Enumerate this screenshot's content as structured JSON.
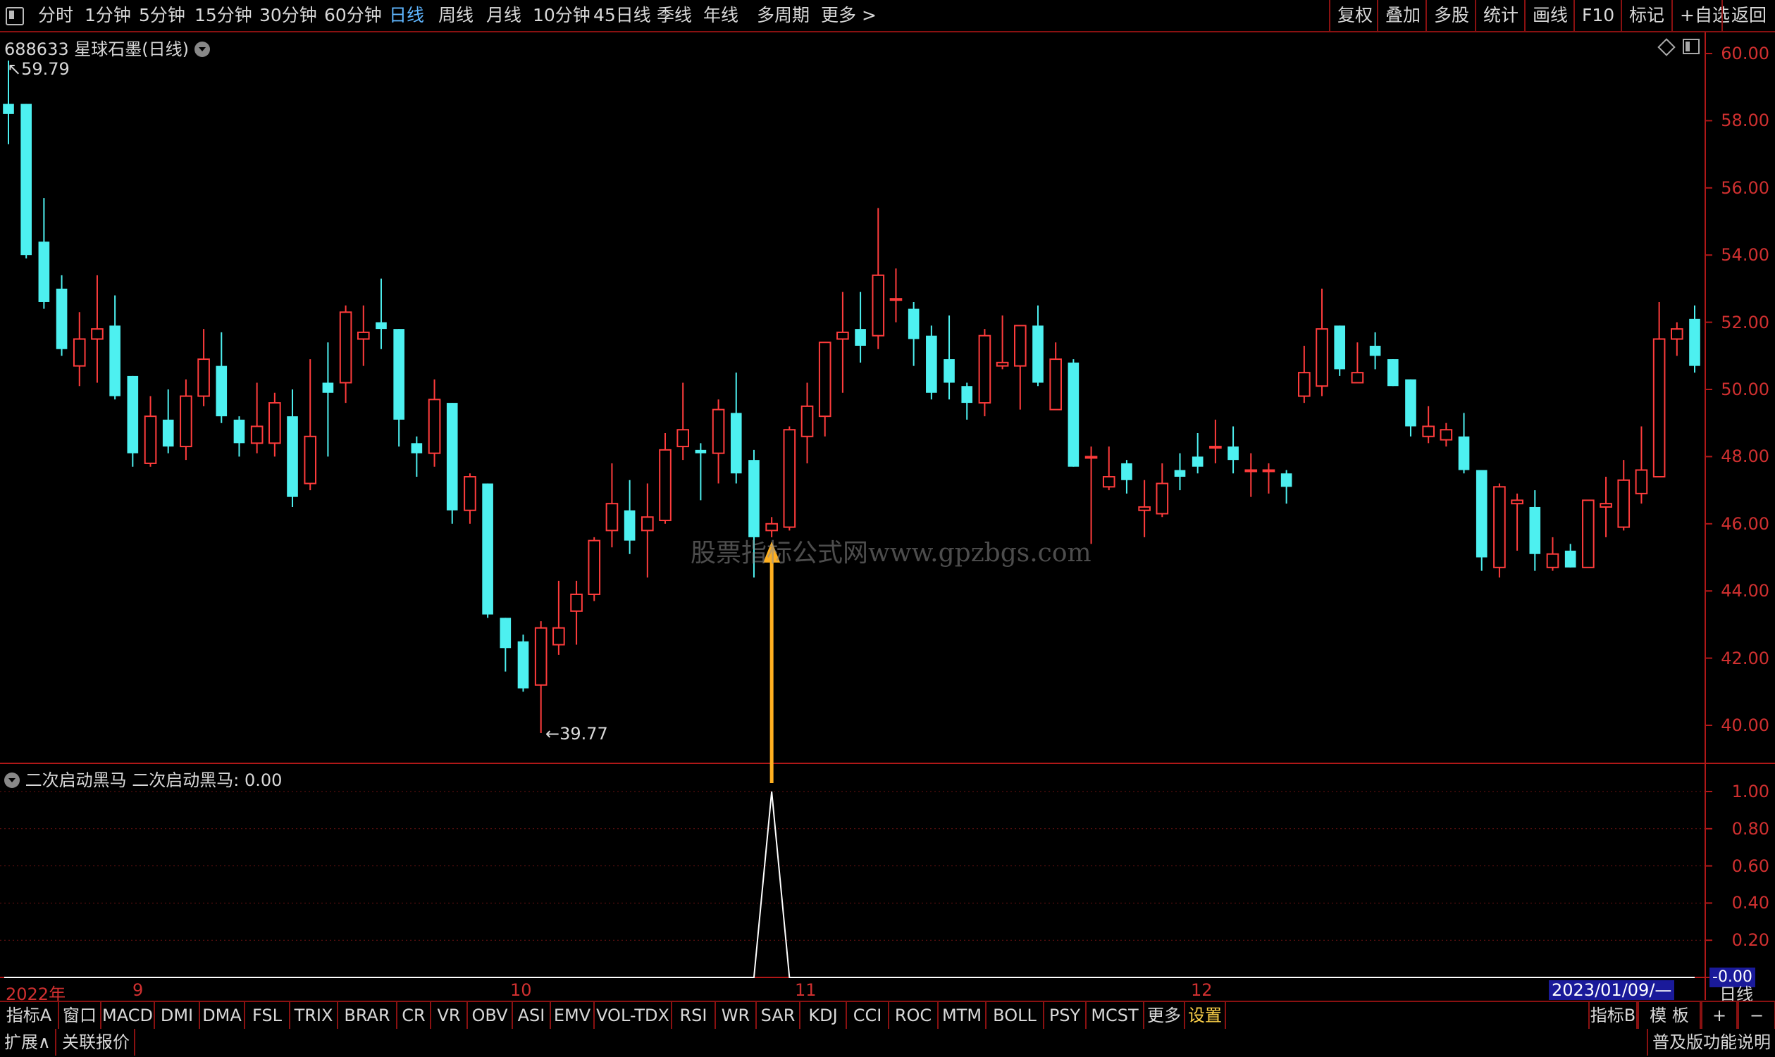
{
  "topbar": {
    "periods": [
      {
        "label": "分时",
        "active": false
      },
      {
        "label": "1分钟",
        "active": false
      },
      {
        "label": "5分钟",
        "active": false
      },
      {
        "label": "15分钟",
        "active": false
      },
      {
        "label": "30分钟",
        "active": false
      },
      {
        "label": "60分钟",
        "active": false
      },
      {
        "label": "日线",
        "active": true
      },
      {
        "label": "周线",
        "active": false
      },
      {
        "label": "月线",
        "active": false
      },
      {
        "label": "10分钟",
        "active": false
      },
      {
        "label": "45日线",
        "active": false
      },
      {
        "label": "季线",
        "active": false
      },
      {
        "label": "年线",
        "active": false
      },
      {
        "label": "多周期",
        "active": false
      },
      {
        "label": "更多 >",
        "active": false
      }
    ],
    "right_buttons": [
      "复权",
      "叠加",
      "多股",
      "统计",
      "画线",
      "F10",
      "标记",
      "+自选",
      "返回"
    ]
  },
  "chart_header": {
    "title": "688633 星球石墨(日线)",
    "high_marker": "59.79",
    "low_marker": "39.77"
  },
  "indicator_header": {
    "name": "二次启动黑马",
    "value_text": "二次启动黑马: 0.00"
  },
  "watermark": "股票指标公式网www.gpzbgs.com",
  "x_axis": {
    "year_label": "2022年",
    "months": [
      "9",
      "10",
      "11",
      "12"
    ],
    "date_badge": "2023/01/09/—",
    "period_label": "日线"
  },
  "colors": {
    "up": "#ff3c3c",
    "down": "#4df0f0",
    "axis": "#b01818",
    "signal_arrow": "#ffb020"
  },
  "chart_data": [
    {
      "type": "candlestick",
      "title": "688633 星球石墨(日线)",
      "ylim": [
        39,
        60.4
      ],
      "y_ticks": [
        "60.00",
        "58.00",
        "56.00",
        "54.00",
        "52.00",
        "50.00",
        "48.00",
        "46.00",
        "44.00",
        "42.00",
        "40.00"
      ],
      "candles": [
        {
          "o": 58.5,
          "c": 58.2,
          "h": 59.79,
          "l": 57.3
        },
        {
          "o": 58.5,
          "c": 54.0,
          "h": 58.5,
          "l": 53.9
        },
        {
          "o": 54.4,
          "c": 52.6,
          "h": 55.7,
          "l": 52.4
        },
        {
          "o": 53.0,
          "c": 51.2,
          "h": 53.4,
          "l": 51.0
        },
        {
          "o": 50.7,
          "c": 51.5,
          "h": 52.3,
          "l": 50.1
        },
        {
          "o": 51.5,
          "c": 51.8,
          "h": 53.4,
          "l": 50.2
        },
        {
          "o": 51.9,
          "c": 49.8,
          "h": 52.8,
          "l": 49.7
        },
        {
          "o": 50.4,
          "c": 48.1,
          "h": 50.4,
          "l": 47.7
        },
        {
          "o": 47.8,
          "c": 49.2,
          "h": 49.8,
          "l": 47.7
        },
        {
          "o": 49.1,
          "c": 48.3,
          "h": 50.0,
          "l": 48.1
        },
        {
          "o": 48.3,
          "c": 49.8,
          "h": 50.3,
          "l": 47.9
        },
        {
          "o": 49.8,
          "c": 50.9,
          "h": 51.8,
          "l": 49.5
        },
        {
          "o": 50.7,
          "c": 49.2,
          "h": 51.7,
          "l": 49.0
        },
        {
          "o": 49.1,
          "c": 48.4,
          "h": 49.2,
          "l": 48.0
        },
        {
          "o": 48.4,
          "c": 48.9,
          "h": 50.2,
          "l": 48.1
        },
        {
          "o": 48.4,
          "c": 49.6,
          "h": 49.9,
          "l": 48.0
        },
        {
          "o": 49.2,
          "c": 46.8,
          "h": 50.0,
          "l": 46.5
        },
        {
          "o": 47.2,
          "c": 48.6,
          "h": 50.9,
          "l": 47.0
        },
        {
          "o": 50.2,
          "c": 49.9,
          "h": 51.4,
          "l": 48.0
        },
        {
          "o": 50.2,
          "c": 52.3,
          "h": 52.5,
          "l": 49.6
        },
        {
          "o": 51.5,
          "c": 51.7,
          "h": 52.5,
          "l": 50.7
        },
        {
          "o": 52.0,
          "c": 51.8,
          "h": 53.3,
          "l": 51.2
        },
        {
          "o": 51.8,
          "c": 49.1,
          "h": 51.8,
          "l": 48.3
        },
        {
          "o": 48.4,
          "c": 48.1,
          "h": 48.6,
          "l": 47.4
        },
        {
          "o": 48.1,
          "c": 49.7,
          "h": 50.3,
          "l": 47.7
        },
        {
          "o": 49.6,
          "c": 46.4,
          "h": 49.6,
          "l": 46.0
        },
        {
          "o": 46.4,
          "c": 47.4,
          "h": 47.5,
          "l": 46.0
        },
        {
          "o": 47.2,
          "c": 43.3,
          "h": 47.2,
          "l": 43.2
        },
        {
          "o": 43.2,
          "c": 42.3,
          "h": 43.2,
          "l": 41.6
        },
        {
          "o": 42.5,
          "c": 41.1,
          "h": 42.7,
          "l": 41.0
        },
        {
          "o": 41.2,
          "c": 42.9,
          "h": 43.1,
          "l": 39.77
        },
        {
          "o": 42.4,
          "c": 42.9,
          "h": 44.3,
          "l": 42.1
        },
        {
          "o": 43.4,
          "c": 43.9,
          "h": 44.3,
          "l": 42.4
        },
        {
          "o": 43.9,
          "c": 45.5,
          "h": 45.6,
          "l": 43.7
        },
        {
          "o": 45.8,
          "c": 46.6,
          "h": 47.8,
          "l": 45.3
        },
        {
          "o": 46.4,
          "c": 45.5,
          "h": 47.3,
          "l": 45.1
        },
        {
          "o": 45.8,
          "c": 46.2,
          "h": 47.2,
          "l": 44.4
        },
        {
          "o": 46.1,
          "c": 48.2,
          "h": 48.7,
          "l": 46.0
        },
        {
          "o": 48.3,
          "c": 48.8,
          "h": 50.2,
          "l": 47.9
        },
        {
          "o": 48.2,
          "c": 48.1,
          "h": 48.4,
          "l": 46.7
        },
        {
          "o": 48.1,
          "c": 49.4,
          "h": 49.7,
          "l": 47.2
        },
        {
          "o": 49.3,
          "c": 47.5,
          "h": 50.5,
          "l": 47.2
        },
        {
          "o": 47.9,
          "c": 45.6,
          "h": 48.2,
          "l": 44.4
        },
        {
          "o": 45.8,
          "c": 46.0,
          "h": 46.2,
          "l": 45.6
        },
        {
          "o": 45.9,
          "c": 48.8,
          "h": 48.9,
          "l": 45.8
        },
        {
          "o": 48.6,
          "c": 49.5,
          "h": 50.2,
          "l": 47.8
        },
        {
          "o": 49.2,
          "c": 51.4,
          "h": 51.4,
          "l": 48.6
        },
        {
          "o": 51.5,
          "c": 51.7,
          "h": 52.9,
          "l": 49.9
        },
        {
          "o": 51.8,
          "c": 51.3,
          "h": 52.9,
          "l": 50.8
        },
        {
          "o": 51.6,
          "c": 53.4,
          "h": 55.4,
          "l": 51.2
        },
        {
          "o": 52.7,
          "c": 52.7,
          "h": 53.6,
          "l": 52.0
        },
        {
          "o": 52.4,
          "c": 51.5,
          "h": 52.6,
          "l": 50.7
        },
        {
          "o": 51.6,
          "c": 49.9,
          "h": 51.9,
          "l": 49.7
        },
        {
          "o": 50.9,
          "c": 50.2,
          "h": 52.2,
          "l": 49.7
        },
        {
          "o": 50.1,
          "c": 49.6,
          "h": 50.2,
          "l": 49.1
        },
        {
          "o": 49.6,
          "c": 51.6,
          "h": 51.8,
          "l": 49.2
        },
        {
          "o": 50.7,
          "c": 50.8,
          "h": 52.2,
          "l": 50.6
        },
        {
          "o": 50.7,
          "c": 51.9,
          "h": 51.9,
          "l": 49.4
        },
        {
          "o": 51.9,
          "c": 50.2,
          "h": 52.5,
          "l": 50.1
        },
        {
          "o": 49.4,
          "c": 50.9,
          "h": 51.4,
          "l": 49.4
        },
        {
          "o": 50.8,
          "c": 47.7,
          "h": 50.9,
          "l": 47.7
        },
        {
          "o": 48.0,
          "c": 48.0,
          "h": 48.3,
          "l": 45.4
        },
        {
          "o": 47.1,
          "c": 47.4,
          "h": 48.3,
          "l": 47.0
        },
        {
          "o": 47.8,
          "c": 47.3,
          "h": 47.9,
          "l": 46.9
        },
        {
          "o": 46.4,
          "c": 46.5,
          "h": 47.3,
          "l": 45.6
        },
        {
          "o": 46.3,
          "c": 47.2,
          "h": 47.8,
          "l": 46.2
        },
        {
          "o": 47.6,
          "c": 47.4,
          "h": 48.1,
          "l": 47.0
        },
        {
          "o": 48.0,
          "c": 47.7,
          "h": 48.7,
          "l": 47.5
        },
        {
          "o": 48.3,
          "c": 48.3,
          "h": 49.1,
          "l": 47.8
        },
        {
          "o": 48.3,
          "c": 47.9,
          "h": 48.9,
          "l": 47.5
        },
        {
          "o": 47.6,
          "c": 47.6,
          "h": 48.1,
          "l": 46.8
        },
        {
          "o": 47.6,
          "c": 47.6,
          "h": 47.8,
          "l": 46.9
        },
        {
          "o": 47.5,
          "c": 47.1,
          "h": 47.6,
          "l": 46.6
        },
        {
          "o": 49.8,
          "c": 50.5,
          "h": 51.3,
          "l": 49.6
        },
        {
          "o": 50.1,
          "c": 51.8,
          "h": 53.0,
          "l": 49.8
        },
        {
          "o": 51.9,
          "c": 50.6,
          "h": 51.9,
          "l": 50.4
        },
        {
          "o": 50.2,
          "c": 50.5,
          "h": 51.4,
          "l": 50.2
        },
        {
          "o": 51.3,
          "c": 51.0,
          "h": 51.7,
          "l": 50.6
        },
        {
          "o": 50.9,
          "c": 50.1,
          "h": 50.9,
          "l": 50.1
        },
        {
          "o": 50.3,
          "c": 48.9,
          "h": 50.3,
          "l": 48.6
        },
        {
          "o": 48.6,
          "c": 48.9,
          "h": 49.5,
          "l": 48.4
        },
        {
          "o": 48.5,
          "c": 48.8,
          "h": 49.0,
          "l": 48.3
        },
        {
          "o": 48.6,
          "c": 47.6,
          "h": 49.3,
          "l": 47.5
        },
        {
          "o": 47.6,
          "c": 45.0,
          "h": 47.6,
          "l": 44.6
        },
        {
          "o": 44.7,
          "c": 47.1,
          "h": 47.2,
          "l": 44.4
        },
        {
          "o": 46.6,
          "c": 46.7,
          "h": 46.9,
          "l": 45.2
        },
        {
          "o": 46.5,
          "c": 45.1,
          "h": 47.0,
          "l": 44.6
        },
        {
          "o": 44.7,
          "c": 45.1,
          "h": 45.6,
          "l": 44.6
        },
        {
          "o": 45.2,
          "c": 44.7,
          "h": 45.4,
          "l": 44.7
        },
        {
          "o": 44.7,
          "c": 46.7,
          "h": 46.7,
          "l": 44.7
        },
        {
          "o": 46.5,
          "c": 46.6,
          "h": 47.4,
          "l": 45.6
        },
        {
          "o": 45.9,
          "c": 47.3,
          "h": 47.9,
          "l": 45.8
        },
        {
          "o": 46.9,
          "c": 47.6,
          "h": 48.9,
          "l": 46.6
        },
        {
          "o": 47.4,
          "c": 51.5,
          "h": 52.6,
          "l": 47.4
        },
        {
          "o": 51.5,
          "c": 51.8,
          "h": 52.0,
          "l": 51.0
        },
        {
          "o": 52.1,
          "c": 50.7,
          "h": 52.5,
          "l": 50.5
        }
      ]
    },
    {
      "type": "line",
      "title": "二次启动黑马",
      "ylim": [
        0,
        1.1
      ],
      "y_ticks": [
        "1.00",
        "0.80",
        "0.60",
        "0.40",
        "0.20",
        "-0.00"
      ],
      "signal_index": 43,
      "values_note_excluded": true
    }
  ],
  "indicator_tabs": [
    "指标A",
    "窗口",
    "MACD",
    "DMI",
    "DMA",
    "FSL",
    "TRIX",
    "BRAR",
    "CR",
    "VR",
    "OBV",
    "ASI",
    "EMV",
    "VOL-TDX",
    "RSI",
    "WR",
    "SAR",
    "KDJ",
    "CCI",
    "ROC",
    "MTM",
    "BOLL",
    "PSY",
    "MCST",
    "更多",
    "设置"
  ],
  "indicator_tabs_right": [
    "指标B",
    "模 板",
    "+",
    "−"
  ],
  "bottom_bar": {
    "left": [
      "扩展∧",
      "关联报价"
    ],
    "right": "普及版功能说明"
  }
}
